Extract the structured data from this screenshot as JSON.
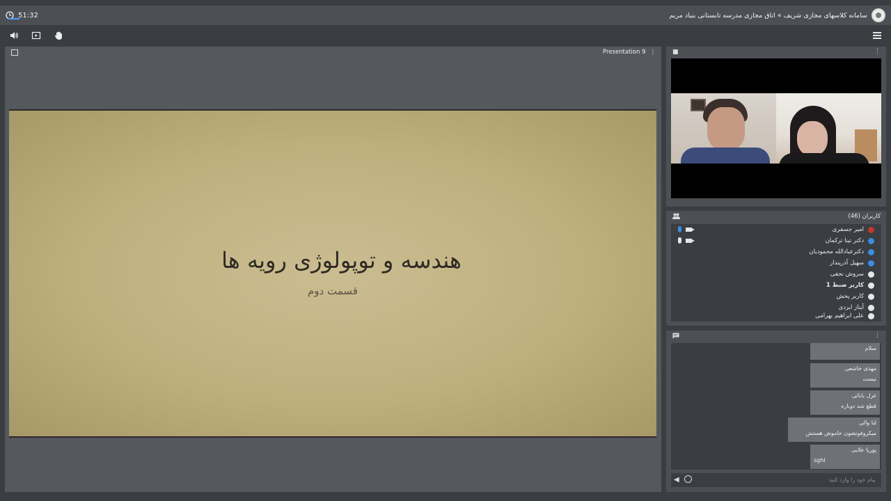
{
  "header": {
    "timer": "51:32",
    "title": "سامانه کلاسهای مجازی شریف » اتاق مجازی مدرسه تابستانی بنیاد مریم"
  },
  "toolbar": {
    "icons": [
      "speaker-icon",
      "screen-share-icon",
      "raise-hand-icon",
      "hamburger-menu-icon"
    ]
  },
  "presentation": {
    "label": "Presentation 9",
    "slide_title": "هندسه و توپولوژی رویه ها",
    "slide_subtitle": "قسمت دوم"
  },
  "users": {
    "header": "کاربران (46)",
    "list": [
      {
        "name": "امیر جسفری",
        "icon_color": "#c0392b",
        "mic": "#3b8de0",
        "cam": true
      },
      {
        "name": "دکتر تینا ترکمان",
        "icon_color": "#3b8de0",
        "mic": "#e6e6e6",
        "cam": true
      },
      {
        "name": "دکترعبادالله محمودیان",
        "icon_color": "#3b8de0"
      },
      {
        "name": "سهیل آذرپندار",
        "icon_color": "#3b8de0"
      },
      {
        "name": "سروش نجفی",
        "icon_color": "#e6e6e6"
      },
      {
        "name": "کاربر ضبط 1",
        "icon_color": "#e6e6e6",
        "bold": true
      },
      {
        "name": "کاربر پخش",
        "icon_color": "#e6e6e6"
      },
      {
        "name": "آیناز ایزدی",
        "icon_color": "#e6e6e6"
      },
      {
        "name": "علی ابراهیم بهرامی",
        "icon_color": "#e6e6e6"
      }
    ]
  },
  "chat": {
    "messages": [
      {
        "author": "",
        "text": "سلام"
      },
      {
        "author": "مهدی خاشعی",
        "text": "نیست"
      },
      {
        "author": "غزل بابائی",
        "text": "قطع شد دوباره"
      },
      {
        "author": "لنا والی",
        "text": "میکروفونشون خاموش هستش"
      },
      {
        "author": "پوریا علایی",
        "text": "sghl"
      }
    ],
    "placeholder": "پیام خود را وارد کنید"
  },
  "colors": {
    "accent": "#4ba3ff",
    "panel": "#4c4f54",
    "background": "#3a3d42"
  }
}
